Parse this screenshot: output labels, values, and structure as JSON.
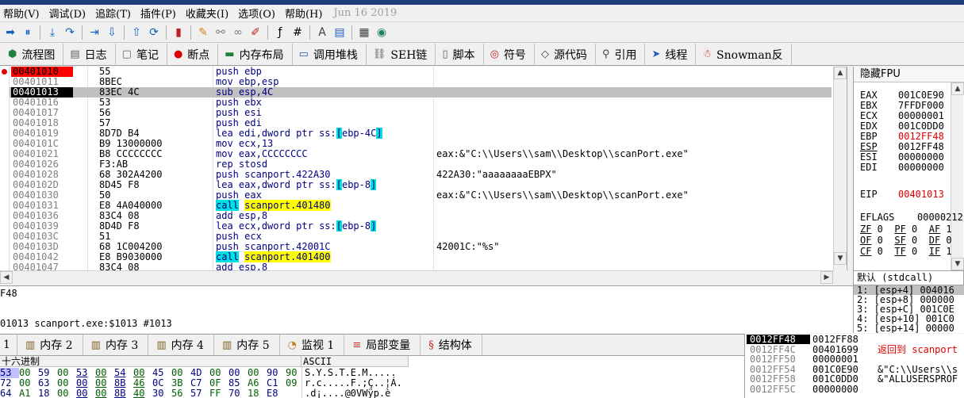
{
  "menu": {
    "items": [
      "帮助(V)",
      "调试(D)",
      "追踪(T)",
      "插件(P)",
      "收藏夹(I)",
      "选项(O)",
      "帮助(H)"
    ],
    "date": "Jun 16 2019"
  },
  "toolbar": {
    "icons": [
      "run-arrow-icon",
      "pause-icon",
      "step-into-icon",
      "step-over-icon",
      "run-to-cursor-icon",
      "run-down-icon",
      "step-out-icon",
      "animate-icon",
      "trace-icon",
      "pencil-icon",
      "attach-icon",
      "link-icon",
      "bookmark-icon",
      "function-icon",
      "hash-icon",
      "font-icon",
      "page-icon",
      "calculator-icon",
      "globe-icon"
    ]
  },
  "tabs": [
    {
      "label": "流程图",
      "icon": "flowchart-icon"
    },
    {
      "label": "日志",
      "icon": "log-icon"
    },
    {
      "label": "笔记",
      "icon": "notes-icon"
    },
    {
      "label": "断点",
      "icon": "breakpoint-icon"
    },
    {
      "label": "内存布局",
      "icon": "memory-map-icon"
    },
    {
      "label": "调用堆栈",
      "icon": "call-stack-icon"
    },
    {
      "label": "SEH链",
      "icon": "seh-chain-icon"
    },
    {
      "label": "脚本",
      "icon": "script-icon"
    },
    {
      "label": "符号",
      "icon": "symbol-icon"
    },
    {
      "label": "源代码",
      "icon": "source-icon"
    },
    {
      "label": "引用",
      "icon": "references-icon"
    },
    {
      "label": "线程",
      "icon": "threads-icon"
    },
    {
      "label": "Snowman反",
      "icon": "snowman-icon"
    }
  ],
  "disasm": [
    {
      "addr": "00401010",
      "bytes": "55",
      "ins": "push ebp",
      "cmt": "",
      "addrStyle": "red",
      "bp": true
    },
    {
      "addr": "00401011",
      "bytes": "8BEC",
      "ins": "mov ebp,esp",
      "cmt": ""
    },
    {
      "addr": "00401013",
      "bytes": "83EC 4C",
      "ins": "sub esp,4C",
      "cmt": "",
      "addrStyle": "black",
      "current": true
    },
    {
      "addr": "00401016",
      "bytes": "53",
      "ins": "push ebx",
      "cmt": ""
    },
    {
      "addr": "00401017",
      "bytes": "56",
      "ins": "push esi",
      "cmt": ""
    },
    {
      "addr": "00401018",
      "bytes": "57",
      "ins": "push edi",
      "cmt": ""
    },
    {
      "addr": "00401019",
      "bytes": "8D7D B4",
      "ins": "lea edi,dword ptr ss:[ebp-4C]",
      "cmt": ""
    },
    {
      "addr": "0040101C",
      "bytes": "B9 13000000",
      "ins": "mov ecx,13",
      "cmt": ""
    },
    {
      "addr": "00401021",
      "bytes": "B8 CCCCCCCC",
      "ins": "mov eax,CCCCCCCC",
      "cmt": "eax:&\"C:\\\\Users\\\\sam\\\\Desktop\\\\scanPort.exe\""
    },
    {
      "addr": "00401026",
      "bytes": "F3:AB",
      "ins": "rep stosd",
      "cmt": ""
    },
    {
      "addr": "00401028",
      "bytes": "68 302A4200",
      "ins": "push scanport.422A30",
      "cmt": "422A30:\"aaaaaaaaEBPX\""
    },
    {
      "addr": "0040102D",
      "bytes": "8D45 F8",
      "ins": "lea eax,dword ptr ss:[ebp-8]",
      "cmt": ""
    },
    {
      "addr": "00401030",
      "bytes": "50",
      "ins": "push eax",
      "cmt": "eax:&\"C:\\\\Users\\\\sam\\\\Desktop\\\\scanPort.exe\""
    },
    {
      "addr": "00401031",
      "bytes": "E8 4A040000",
      "ins": "call scanport.401480",
      "cmt": ""
    },
    {
      "addr": "00401036",
      "bytes": "83C4 08",
      "ins": "add esp,8",
      "cmt": ""
    },
    {
      "addr": "00401039",
      "bytes": "8D4D F8",
      "ins": "lea ecx,dword ptr ss:[ebp-8]",
      "cmt": ""
    },
    {
      "addr": "0040103C",
      "bytes": "51",
      "ins": "push ecx",
      "cmt": ""
    },
    {
      "addr": "0040103D",
      "bytes": "68 1C004200",
      "ins": "push scanport.42001C",
      "cmt": "42001C:\"%s\""
    },
    {
      "addr": "00401042",
      "bytes": "E8 B9030000",
      "ins": "call scanport.401400",
      "cmt": ""
    },
    {
      "addr": "00401047",
      "bytes": "83C4 08",
      "ins": "add esp,8",
      "cmt": ""
    }
  ],
  "registers": {
    "header": "隐藏FPU",
    "items": [
      {
        "name": "EAX",
        "value": "001C0E90"
      },
      {
        "name": "EBX",
        "value": "7FFDF000"
      },
      {
        "name": "ECX",
        "value": "00000001"
      },
      {
        "name": "EDX",
        "value": "001C0DD0"
      },
      {
        "name": "EBP",
        "value": "0012FF48",
        "changed": true
      },
      {
        "name": "ESP",
        "value": "0012FF48",
        "underline": true
      },
      {
        "name": "ESI",
        "value": "00000000"
      },
      {
        "name": "EDI",
        "value": "00000000"
      }
    ],
    "eip": {
      "name": "EIP",
      "value": "00401013"
    },
    "eflags": {
      "name": "EFLAGS",
      "value": "00000212"
    },
    "flags": [
      [
        "ZF",
        "0",
        "PF",
        "0",
        "AF",
        "1"
      ],
      [
        "OF",
        "0",
        "SF",
        "0",
        "DF",
        "0"
      ],
      [
        "CF",
        "0",
        "TF",
        "0",
        "IF",
        "1"
      ]
    ]
  },
  "callconv": "默认 (stdcall)",
  "args": [
    "1: [esp+4] 004016",
    "2: [esp+8] 000000",
    "3: [esp+C] 001C0E",
    "4: [esp+10] 001C0",
    "5: [esp+14] 00000"
  ],
  "info": {
    "line1": "F48",
    "line2": "01013 scanport.exe:$1013 #1013"
  },
  "bottomTabs": [
    {
      "label": "内存 2",
      "icon": "memory-icon"
    },
    {
      "label": "内存 3",
      "icon": "memory-icon"
    },
    {
      "label": "内存 4",
      "icon": "memory-icon"
    },
    {
      "label": "内存 5",
      "icon": "memory-icon"
    },
    {
      "label": "监视 1",
      "icon": "watch-icon"
    },
    {
      "label": "局部变量",
      "icon": "locals-icon"
    },
    {
      "label": "结构体",
      "icon": "struct-icon"
    }
  ],
  "dump": {
    "hexHeader": "十六进制",
    "asciiHeader": "ASCII",
    "rows": [
      {
        "hex": [
          "53",
          "00",
          "59",
          "00",
          "53",
          "00",
          "54",
          "00",
          "45",
          "00",
          "4D",
          "00",
          "00",
          "00",
          "90",
          "90"
        ],
        "ascii": "S.Y.S.T.E.M....."
      },
      {
        "hex": [
          "72",
          "00",
          "63",
          "00",
          "00",
          "00",
          "8B",
          "46",
          "0C",
          "3B",
          "C7",
          "0F",
          "85",
          "A6",
          "C1",
          "09"
        ],
        "ascii": "r.c.....F.;Ç..¦Á."
      },
      {
        "hex": [
          "64",
          "A1",
          "18",
          "00",
          "00",
          "00",
          "8B",
          "40",
          "30",
          "56",
          "57",
          "FF",
          "70",
          "18",
          "E8",
          ""
        ],
        "ascii": ".d¡....@0VWÿp.è"
      }
    ]
  },
  "stack": {
    "rows": [
      {
        "addr": "0012FF48",
        "val": "0012FF88",
        "cmt": "",
        "sel": true
      },
      {
        "addr": "0012FF4C",
        "val": "00401699",
        "cmt": "返回到 scanport",
        "red": true
      },
      {
        "addr": "0012FF50",
        "val": "00000001",
        "cmt": ""
      },
      {
        "addr": "0012FF54",
        "val": "001C0E90",
        "cmt": "&\"C:\\\\Users\\\\s"
      },
      {
        "addr": "0012FF58",
        "val": "001C0DD0",
        "cmt": "&\"ALLUSERSPROF"
      },
      {
        "addr": "0012FF5C",
        "val": "00000000",
        "cmt": ""
      }
    ]
  }
}
